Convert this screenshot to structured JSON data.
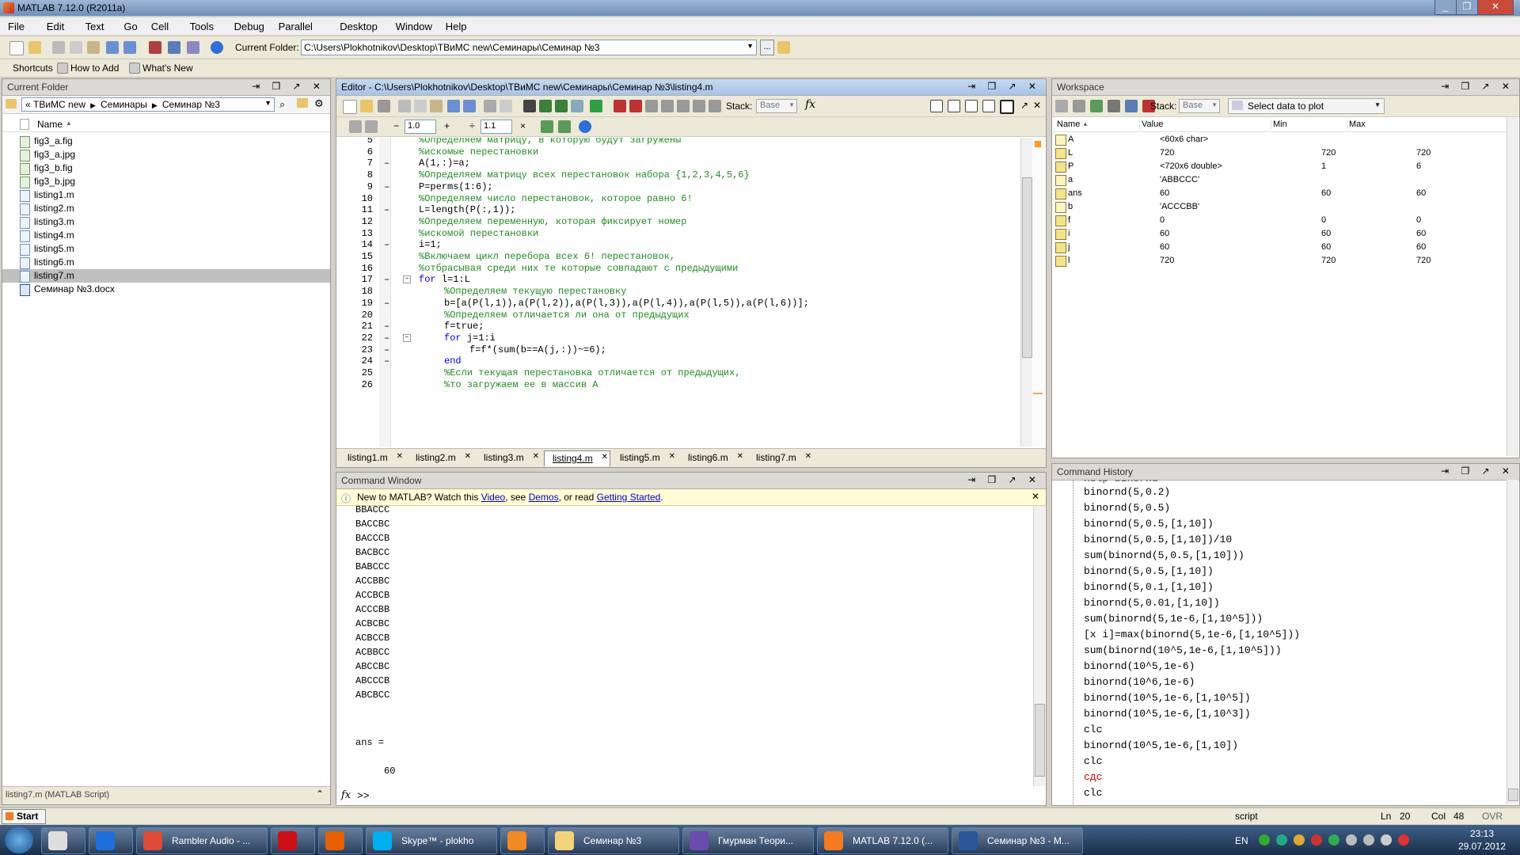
{
  "window": {
    "title": "MATLAB  7.12.0 (R2011a)"
  },
  "menu": [
    "File",
    "Edit",
    "Text",
    "Go",
    "Cell",
    "Tools",
    "Debug",
    "Parallel",
    "Desktop",
    "Window",
    "Help"
  ],
  "toolbar": {
    "current_folder_label": "Current Folder:",
    "current_folder_path": "C:\\Users\\Plokhotnikov\\Desktop\\ТВиМС new\\Семинары\\Семинар №3",
    "browse_label": "...",
    "up_folder_label": ""
  },
  "shortcuts": {
    "shortcuts": "Shortcuts",
    "how_to_add": "How to Add",
    "whats_new": "What's New"
  },
  "current_folder": {
    "title": "Current Folder",
    "breadcrumb": [
      "« ТВиМС new",
      "Семинары",
      "Семинар №3"
    ],
    "column_name": "Name",
    "files": [
      {
        "name": "fig3_a.fig",
        "kind": "fig"
      },
      {
        "name": "fig3_a.jpg",
        "kind": "img"
      },
      {
        "name": "fig3_b.fig",
        "kind": "fig"
      },
      {
        "name": "fig3_b.jpg",
        "kind": "img"
      },
      {
        "name": "listing1.m",
        "kind": "m"
      },
      {
        "name": "listing2.m",
        "kind": "m"
      },
      {
        "name": "listing3.m",
        "kind": "m"
      },
      {
        "name": "listing4.m",
        "kind": "m"
      },
      {
        "name": "listing5.m",
        "kind": "m"
      },
      {
        "name": "listing6.m",
        "kind": "m"
      },
      {
        "name": "listing7.m",
        "kind": "m"
      },
      {
        "name": "Семинар №3.docx",
        "kind": "doc"
      }
    ],
    "selected_index": 10,
    "details": "listing7.m  (MATLAB Script)"
  },
  "editor": {
    "title": "Editor - C:\\Users\\Plokhotnikov\\Desktop\\ТВиМС new\\Семинары\\Семинар №3\\listing4.m",
    "stack_label": "Stack:",
    "stack_value": "Base",
    "fx_label": "fx",
    "cell_minus": "−",
    "cell_value1": "1.0",
    "cell_plus": "+",
    "cell_div": "÷",
    "cell_value2": "1.1",
    "cell_x": "×",
    "lines": [
      {
        "n": "5",
        "dash": "",
        "indent": 0,
        "kind": "cm",
        "text": "%Определяем матрицу, в которую будут загружены"
      },
      {
        "n": "6",
        "dash": "",
        "indent": 0,
        "kind": "cm",
        "text": "%искомые перестановки"
      },
      {
        "n": "7",
        "dash": "–",
        "indent": 0,
        "kind": "code",
        "text": "A(1,:)=a;"
      },
      {
        "n": "8",
        "dash": "",
        "indent": 0,
        "kind": "cm",
        "text": "%Определяем матрицу всех перестановок набора {1,2,3,4,5,6}"
      },
      {
        "n": "9",
        "dash": "–",
        "indent": 0,
        "kind": "code",
        "text": "P=perms(1:6);"
      },
      {
        "n": "10",
        "dash": "",
        "indent": 0,
        "kind": "cm",
        "text": "%Определяем число перестановок, которое равно 6!"
      },
      {
        "n": "11",
        "dash": "–",
        "indent": 0,
        "kind": "code",
        "text": "L=length(P(:,1));"
      },
      {
        "n": "12",
        "dash": "",
        "indent": 0,
        "kind": "cm",
        "text": "%Определяем переменную, которая фиксирует номер"
      },
      {
        "n": "13",
        "dash": "",
        "indent": 0,
        "kind": "cm",
        "text": "%искомой перестановки"
      },
      {
        "n": "14",
        "dash": "–",
        "indent": 0,
        "kind": "code",
        "text": "i=1;"
      },
      {
        "n": "15",
        "dash": "",
        "indent": 0,
        "kind": "cm",
        "text": "%Включаем цикл перебора всех 6! перестановок,"
      },
      {
        "n": "16",
        "dash": "",
        "indent": 0,
        "kind": "cm",
        "text": "%отбрасывая среди них те которые совпадают с предыдущими"
      },
      {
        "n": "17",
        "dash": "–",
        "indent": 0,
        "kind": "for",
        "kw": "for",
        "text": " l=1:L"
      },
      {
        "n": "18",
        "dash": "",
        "indent": 1,
        "kind": "cm",
        "text": "%Определяем текущую перестановку"
      },
      {
        "n": "19",
        "dash": "–",
        "indent": 1,
        "kind": "code",
        "text": "b=[a(P(l,1)),a(P(l,2)),a(P(l,3)),a(P(l,4)),a(P(l,5)),a(P(l,6))];"
      },
      {
        "n": "20",
        "dash": "",
        "indent": 1,
        "kind": "cm",
        "text": "%Определяем отличается ли она от предыдущих"
      },
      {
        "n": "21",
        "dash": "–",
        "indent": 1,
        "kind": "code",
        "text": "f=true;"
      },
      {
        "n": "22",
        "dash": "–",
        "indent": 1,
        "kind": "for",
        "kw": "for",
        "text": " j=1:i"
      },
      {
        "n": "23",
        "dash": "–",
        "indent": 2,
        "kind": "code",
        "text": "f=f*(sum(b==A(j,:))~=6);"
      },
      {
        "n": "24",
        "dash": "–",
        "indent": 1,
        "kind": "kwonly",
        "kw": "end",
        "text": ""
      },
      {
        "n": "25",
        "dash": "",
        "indent": 1,
        "kind": "cm",
        "text": "%Если текущая перестановка отличается от предыдущих,"
      },
      {
        "n": "26",
        "dash": "",
        "indent": 1,
        "kind": "cm",
        "text": "%то загружаем ее в массив A"
      }
    ],
    "tabs": [
      "listing1.m",
      "listing2.m",
      "listing3.m",
      "listing4.m",
      "listing5.m",
      "listing6.m",
      "listing7.m"
    ],
    "active_tab": 3
  },
  "command_window": {
    "title": "Command Window",
    "notice_prefix": "New to MATLAB? Watch this ",
    "notice_video": "Video",
    "notice_mid1": ", see ",
    "notice_demos": "Demos",
    "notice_mid2": ", or read ",
    "notice_getting_started": "Getting Started",
    "notice_end": ".",
    "output": [
      "BBACCC",
      "BACCBC",
      "BACCCB",
      "BACBCC",
      "BABCCC",
      "ACCBBC",
      "ACCBCB",
      "ACCCBB",
      "ACBCBC",
      "ACBCCB",
      "ACBBCC",
      "ABCCBC",
      "ABCCCB",
      "ABCBCC"
    ],
    "ans_label": "ans =",
    "ans_value": "60",
    "prompt": ">>",
    "fx": "fx"
  },
  "workspace": {
    "title": "Workspace",
    "stack_label": "Stack:",
    "stack_value": "Base",
    "plot_select": "Select data to plot",
    "columns": [
      "Name",
      "Value",
      "Min",
      "Max"
    ],
    "vars": [
      {
        "name": "A",
        "value": "<60x6 char>",
        "min": "",
        "max": "",
        "type": "char"
      },
      {
        "name": "L",
        "value": "720",
        "min": "720",
        "max": "720",
        "type": "num"
      },
      {
        "name": "P",
        "value": "<720x6 double>",
        "min": "1",
        "max": "6",
        "type": "num"
      },
      {
        "name": "a",
        "value": "'ABBCCC'",
        "min": "",
        "max": "",
        "type": "char"
      },
      {
        "name": "ans",
        "value": "60",
        "min": "60",
        "max": "60",
        "type": "num"
      },
      {
        "name": "b",
        "value": "'ACCCBB'",
        "min": "",
        "max": "",
        "type": "char"
      },
      {
        "name": "f",
        "value": "0",
        "min": "0",
        "max": "0",
        "type": "num"
      },
      {
        "name": "i",
        "value": "60",
        "min": "60",
        "max": "60",
        "type": "num"
      },
      {
        "name": "j",
        "value": "60",
        "min": "60",
        "max": "60",
        "type": "num"
      },
      {
        "name": "l",
        "value": "720",
        "min": "720",
        "max": "720",
        "type": "num"
      }
    ]
  },
  "command_history": {
    "title": "Command History",
    "top_partial": "help binornd",
    "items": [
      {
        "text": "binornd(5,0.2)",
        "red": false
      },
      {
        "text": "binornd(5,0.5)",
        "red": false
      },
      {
        "text": "binornd(5,0.5,[1,10])",
        "red": false
      },
      {
        "text": "binornd(5,0.5,[1,10])/10",
        "red": false
      },
      {
        "text": "sum(binornd(5,0.5,[1,10]))",
        "red": false
      },
      {
        "text": "binornd(5,0.5,[1,10])",
        "red": false
      },
      {
        "text": "binornd(5,0.1,[1,10])",
        "red": false
      },
      {
        "text": "binornd(5,0.01,[1,10])",
        "red": false
      },
      {
        "text": "sum(binornd(5,1e-6,[1,10^5]))",
        "red": false
      },
      {
        "text": "[x i]=max(binornd(5,1e-6,[1,10^5]))",
        "red": false
      },
      {
        "text": "sum(binornd(10^5,1e-6,[1,10^5]))",
        "red": false
      },
      {
        "text": "binornd(10^5,1e-6)",
        "red": false
      },
      {
        "text": "binornd(10^6,1e-6)",
        "red": false
      },
      {
        "text": "binornd(10^5,1e-6,[1,10^5])",
        "red": false
      },
      {
        "text": "binornd(10^5,1e-6,[1,10^3])",
        "red": false
      },
      {
        "text": "clc",
        "red": false
      },
      {
        "text": "binornd(10^5,1e-6,[1,10])",
        "red": false
      },
      {
        "text": "clc",
        "red": false
      },
      {
        "text": "сдс",
        "red": true
      },
      {
        "text": "clc",
        "red": false
      }
    ]
  },
  "statusbar": {
    "start": "Start",
    "mode": "script",
    "ln_label": "Ln",
    "ln": "20",
    "col_label": "Col",
    "col": "48",
    "ovr": "OVR"
  },
  "taskbar": {
    "items": [
      {
        "label": "",
        "color": "#ddd"
      },
      {
        "label": "",
        "color": "#1e6fd9"
      },
      {
        "label": "Rambler Audio - ...",
        "color": "#dd4b39"
      },
      {
        "label": "",
        "color": "#cc0f16"
      },
      {
        "label": "",
        "color": "#e66000"
      },
      {
        "label": "Skype™ - plokho",
        "color": "#00aff0"
      },
      {
        "label": "",
        "color": "#f08a24"
      },
      {
        "label": "Семинар №3",
        "color": "#f3d37a"
      },
      {
        "label": "Гмурман Теори...",
        "color": "#6a4caf"
      },
      {
        "label": "MATLAB  7.12.0 (...",
        "color": "#f47b20"
      },
      {
        "label": "Семинар №3 - M...",
        "color": "#2b579a"
      }
    ],
    "lang": "EN",
    "time": "23:13",
    "date": "29.07.2012"
  }
}
